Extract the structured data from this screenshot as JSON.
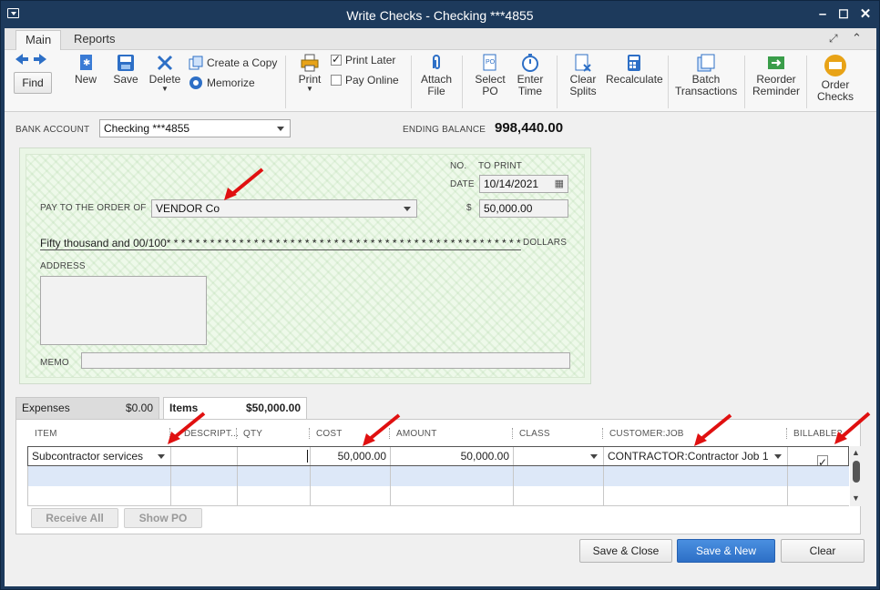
{
  "window": {
    "title": "Write Checks - Checking ***4855"
  },
  "tabs": [
    "Main",
    "Reports"
  ],
  "ribbon": {
    "find": "Find",
    "new": "New",
    "save": "Save",
    "delete": "Delete",
    "create_copy": "Create a Copy",
    "memorize": "Memorize",
    "print": "Print",
    "print_later": "Print Later",
    "pay_online": "Pay Online",
    "attach_file": [
      "Attach",
      "File"
    ],
    "select_po": [
      "Select",
      "PO"
    ],
    "enter_time": [
      "Enter",
      "Time"
    ],
    "clear_splits": [
      "Clear",
      "Splits"
    ],
    "recalculate": "Recalculate",
    "batch_transactions": [
      "Batch",
      "Transactions"
    ],
    "reorder_reminder": [
      "Reorder",
      "Reminder"
    ],
    "order_checks": [
      "Order",
      "Checks"
    ]
  },
  "bank": {
    "label": "BANK ACCOUNT",
    "account": "Checking ***4855",
    "ending_balance_label": "ENDING BALANCE",
    "ending_balance": "998,440.00"
  },
  "check": {
    "no_label": "NO.",
    "no_value": "TO PRINT",
    "date_label": "DATE",
    "date": "10/14/2021",
    "pay_label": "PAY TO THE ORDER OF",
    "payee": "VENDOR Co",
    "dollar_sign": "$",
    "amount": "50,000.00",
    "amount_words": "Fifty thousand  and 00/100* * * * * * * * * * * * * * * * * * * * * * * * * * * * * * * * * * * * * * * * * * * * * * * * * *",
    "dollars_label": "DOLLARS",
    "address_label": "ADDRESS",
    "memo_label": "MEMO"
  },
  "lower_tabs": {
    "expenses_label": "Expenses",
    "expenses_amount": "$0.00",
    "items_label": "Items",
    "items_amount": "$50,000.00"
  },
  "grid": {
    "headers": [
      "ITEM",
      "DESCRIPT...",
      "QTY",
      "COST",
      "AMOUNT",
      "CLASS",
      "CUSTOMER:JOB",
      "BILLABLE?"
    ],
    "row1": {
      "item": "Subcontractor services",
      "cost": "50,000.00",
      "amount": "50,000.00",
      "customer": "CONTRACTOR:Contractor Job 1"
    }
  },
  "buttons": {
    "receive_all": "Receive All",
    "show_po": "Show PO",
    "save_close": "Save & Close",
    "save_new": "Save & New",
    "clear": "Clear"
  },
  "colors": {
    "titlebar": "#1d3a5c",
    "check_bg": "#eaf6e6",
    "primary_button": "#2d6fc6",
    "annotation_arrow": "#e01010"
  }
}
